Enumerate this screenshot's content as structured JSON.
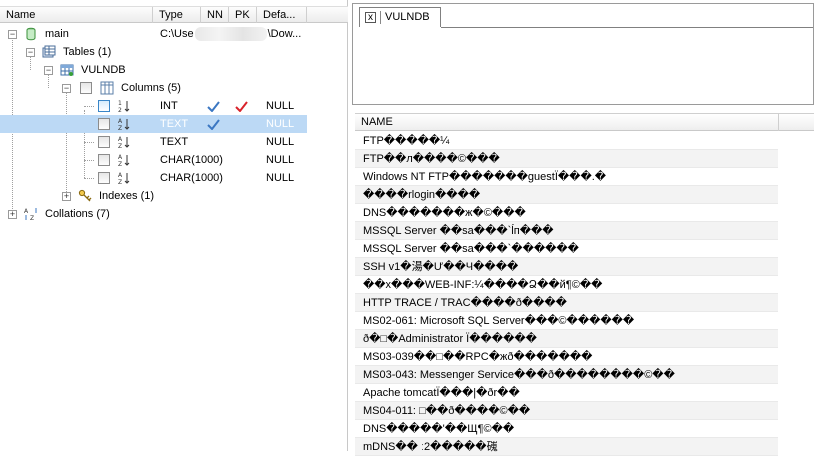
{
  "tree": {
    "columns": {
      "name": "Name",
      "type": "Type",
      "nn": "NN",
      "pk": "PK",
      "default": "Defa..."
    },
    "db_name": "main",
    "db_path_prefix": "C:\\Use",
    "db_path_suffix": "\\Dow...",
    "tables_label": "Tables (1)",
    "table_name": "VULNDB",
    "columns_label": "Columns (5)",
    "fields": [
      {
        "type": "INT",
        "default": "NULL",
        "nn": true,
        "pk": true
      },
      {
        "type": "TEXT",
        "default": "NULL",
        "nn": true,
        "pk": false,
        "selected": true
      },
      {
        "type": "TEXT",
        "default": "NULL",
        "nn": false,
        "pk": false
      },
      {
        "type": "CHAR(1000)",
        "default": "NULL",
        "nn": false,
        "pk": false
      },
      {
        "type": "CHAR(1000)",
        "default": "NULL",
        "nn": false,
        "pk": false
      }
    ],
    "indexes_label": "Indexes (1)",
    "collations_label": "Collations (7)"
  },
  "tab": {
    "label": "VULNDB",
    "close": "x"
  },
  "grid": {
    "header": "NAME",
    "rows": [
      "FTP�����¼",
      "FTP��л����©���",
      "Windows NT FTP�������guestÏ���.�",
      "����rlogin����",
      "DNS�������ж�©���",
      "MSSQL Server ��sa���`ĺп���",
      "MSSQL Server ��sa���`������",
      "SSH v1�湯�Ư��Ч����",
      "��x���WEB-INF:¼����Ձ��й¶©��",
      "HTTP TRACE / TRAC����ð����",
      "MS02-061: Microsoft SQL Server���©������",
      "ð�□�Administrator Ï������",
      "MS03-039��□��RPC�жð�������",
      "MS03-043: Messenger Service���ð��������©��",
      "Apache tomcatÏ���|�ðr��",
      "MS04-011: □��ð����©��",
      "DNS�����'��Щ¶©��",
      "mDNS�� ː2�����䃬"
    ]
  },
  "colors": {
    "selection": "#bcd9f5",
    "check_blue": "#3b77c2",
    "check_red": "#d9232b",
    "header_bg": "#ececec"
  },
  "icons": [
    "database-icon",
    "tables-icon",
    "table-icon",
    "columns-icon",
    "sort-field-icon",
    "key-icon",
    "collations-icon",
    "check-icon"
  ]
}
